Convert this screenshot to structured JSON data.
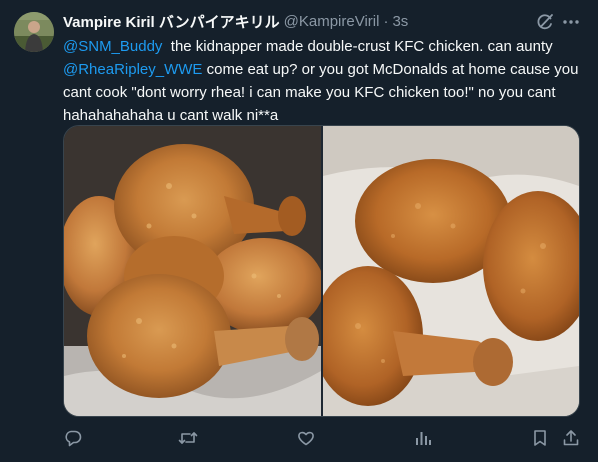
{
  "tweet": {
    "display_name": "Vampire Kiril バンパイアキリル",
    "handle": "@KampireViril",
    "separator": "·",
    "time": "3s",
    "text_segments": [
      {
        "type": "mention",
        "text": "@SNM_Buddy"
      },
      {
        "type": "text",
        "text": "  the kidnapper made double-crust KFC chicken. can aunty "
      },
      {
        "type": "mention",
        "text": "@RheaRipley_WWE"
      },
      {
        "type": "text",
        "text": " come eat up? or you got McDonalds at home cause you cant cook \"dont worry rhea! i can make you KFC chicken too!\" no you cant hahahahahaha u cant walk ni**a"
      }
    ],
    "media": [
      {
        "alt": "fried-chicken-photo-left"
      },
      {
        "alt": "fried-chicken-photo-right"
      }
    ]
  },
  "icons": {
    "grok": "grok-icon",
    "more": "more-icon",
    "reply": "reply-icon",
    "retweet": "retweet-icon",
    "like": "like-icon",
    "views": "views-icon",
    "bookmark": "bookmark-icon",
    "share": "share-icon"
  },
  "colors": {
    "background": "#15202b",
    "text": "#f7f9f9",
    "secondary": "#8b98a5",
    "link": "#1d9bf0",
    "border": "#38444d"
  }
}
